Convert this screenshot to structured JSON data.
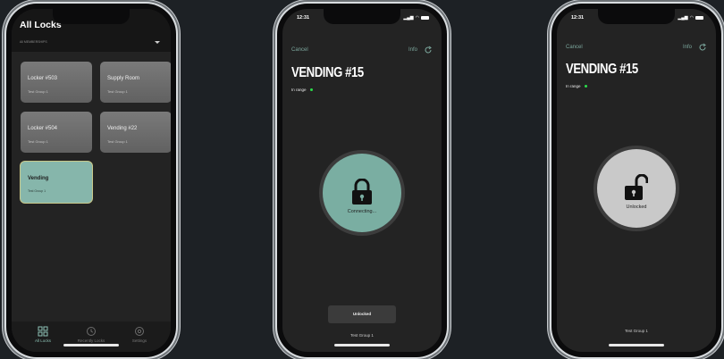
{
  "phone1": {
    "title": "All Locks",
    "selector": "All MEMBERSHIPS",
    "tiles": [
      {
        "name": "Locker #503",
        "group": "Test Group 1"
      },
      {
        "name": "Supply Room",
        "group": "Test Group 1"
      },
      {
        "name": "Locker #504",
        "group": "Test Group 1"
      },
      {
        "name": "Vending #22",
        "group": "Test Group 1"
      },
      {
        "name": "Vending",
        "group": "Test Group 1"
      }
    ],
    "tabs": [
      {
        "label": "All Locks",
        "icon": "grid-icon"
      },
      {
        "label": "Recently Locks",
        "icon": "clock-icon"
      },
      {
        "label": "Settings",
        "icon": "gear-icon"
      }
    ]
  },
  "phone2": {
    "time": "12:31",
    "cancel": "Cancel",
    "info": "Info",
    "title": "VENDING #15",
    "range": "In range",
    "status": "Connecting...",
    "status_color": "#7aaea2",
    "toast": "Unlocked",
    "group": "Test Group 1"
  },
  "phone3": {
    "time": "12:31",
    "cancel": "Cancel",
    "info": "Info",
    "title": "VENDING #15",
    "range": "In range",
    "status": "Unlocked",
    "status_color": "#c9c9c9",
    "group": "Test Group 1"
  },
  "colors": {
    "accent": "#86b6ab",
    "in_range": "#2bdc4a"
  }
}
